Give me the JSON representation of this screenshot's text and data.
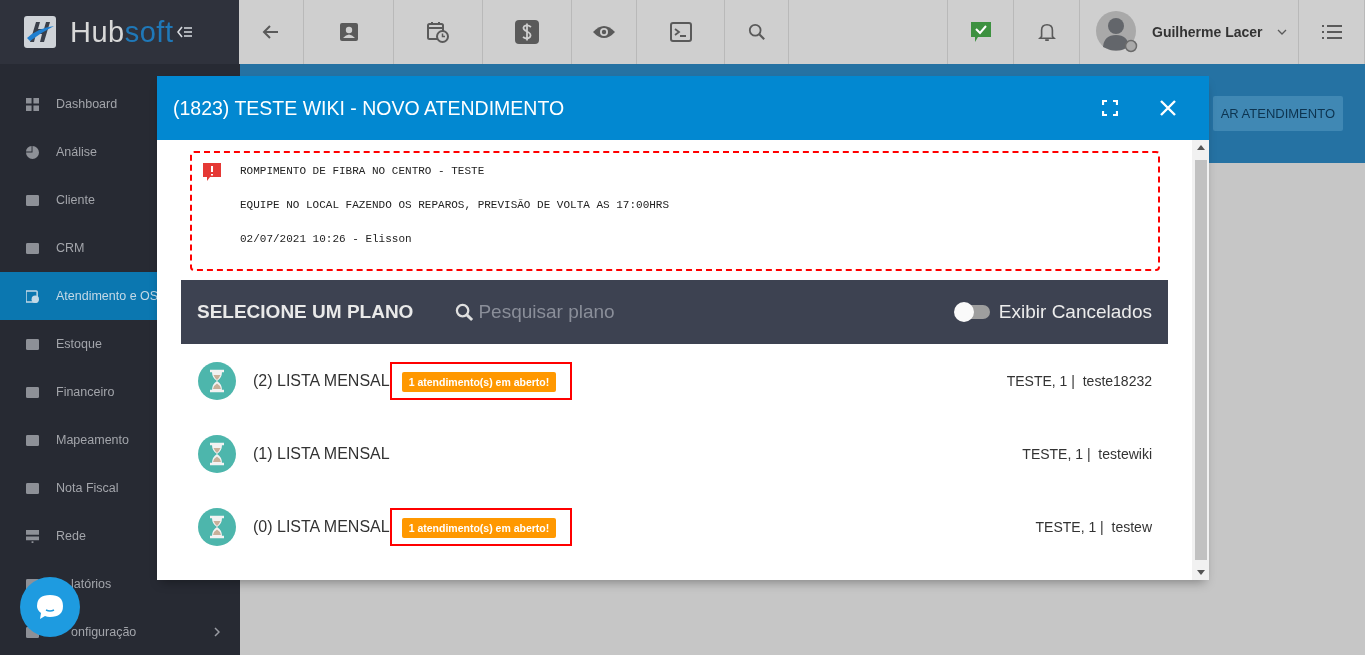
{
  "topbar": {
    "logo_parts": [
      "Hub",
      "soft"
    ],
    "user_name": "Guilherme Lacer"
  },
  "sidebar": {
    "items": [
      {
        "label": "Dashboard",
        "selected": false
      },
      {
        "label": "Análise",
        "selected": false
      },
      {
        "label": "Cliente",
        "selected": false
      },
      {
        "label": "CRM",
        "selected": false
      },
      {
        "label": "Atendimento e OS",
        "selected": true
      },
      {
        "label": "Estoque",
        "selected": false
      },
      {
        "label": "Financeiro",
        "selected": false
      },
      {
        "label": "Mapeamento",
        "selected": false
      },
      {
        "label": "Nota Fiscal",
        "selected": false
      },
      {
        "label": "Rede",
        "selected": false
      },
      {
        "label": "latórios",
        "selected": false
      },
      {
        "label": "onfiguração",
        "selected": false
      }
    ]
  },
  "background": {
    "button": "AR ATENDIMENTO"
  },
  "modal": {
    "title": "(1823) TESTE WIKI - NOVO ATENDIMENTO",
    "alert": {
      "lines": [
        "ROMPIMENTO DE FIBRA NO CENTRO - TESTE",
        "EQUIPE NO LOCAL FAZENDO OS REPAROS, PREVISÃO DE VOLTA AS 17:00HRS",
        "02/07/2021 10:26 - Elisson"
      ]
    },
    "plans": {
      "title": "SELECIONE UM PLANO",
      "search": {
        "placeholder": "Pesquisar plano"
      },
      "toggle": {
        "label": "Exibir Cancelados",
        "on": false
      },
      "rows": [
        {
          "name": "(2) LISTA MENSAL",
          "badge": "1 atendimento(s) em aberto!",
          "detail": "TESTE, 1 |  teste18232"
        },
        {
          "name": "(1) LISTA MENSAL",
          "detail": "TESTE, 1 |  testewiki"
        },
        {
          "name": "(0) LISTA MENSAL",
          "badge": "1 atendimento(s) em aberto!",
          "detail": "TESTE, 1 |  testew"
        }
      ]
    }
  }
}
